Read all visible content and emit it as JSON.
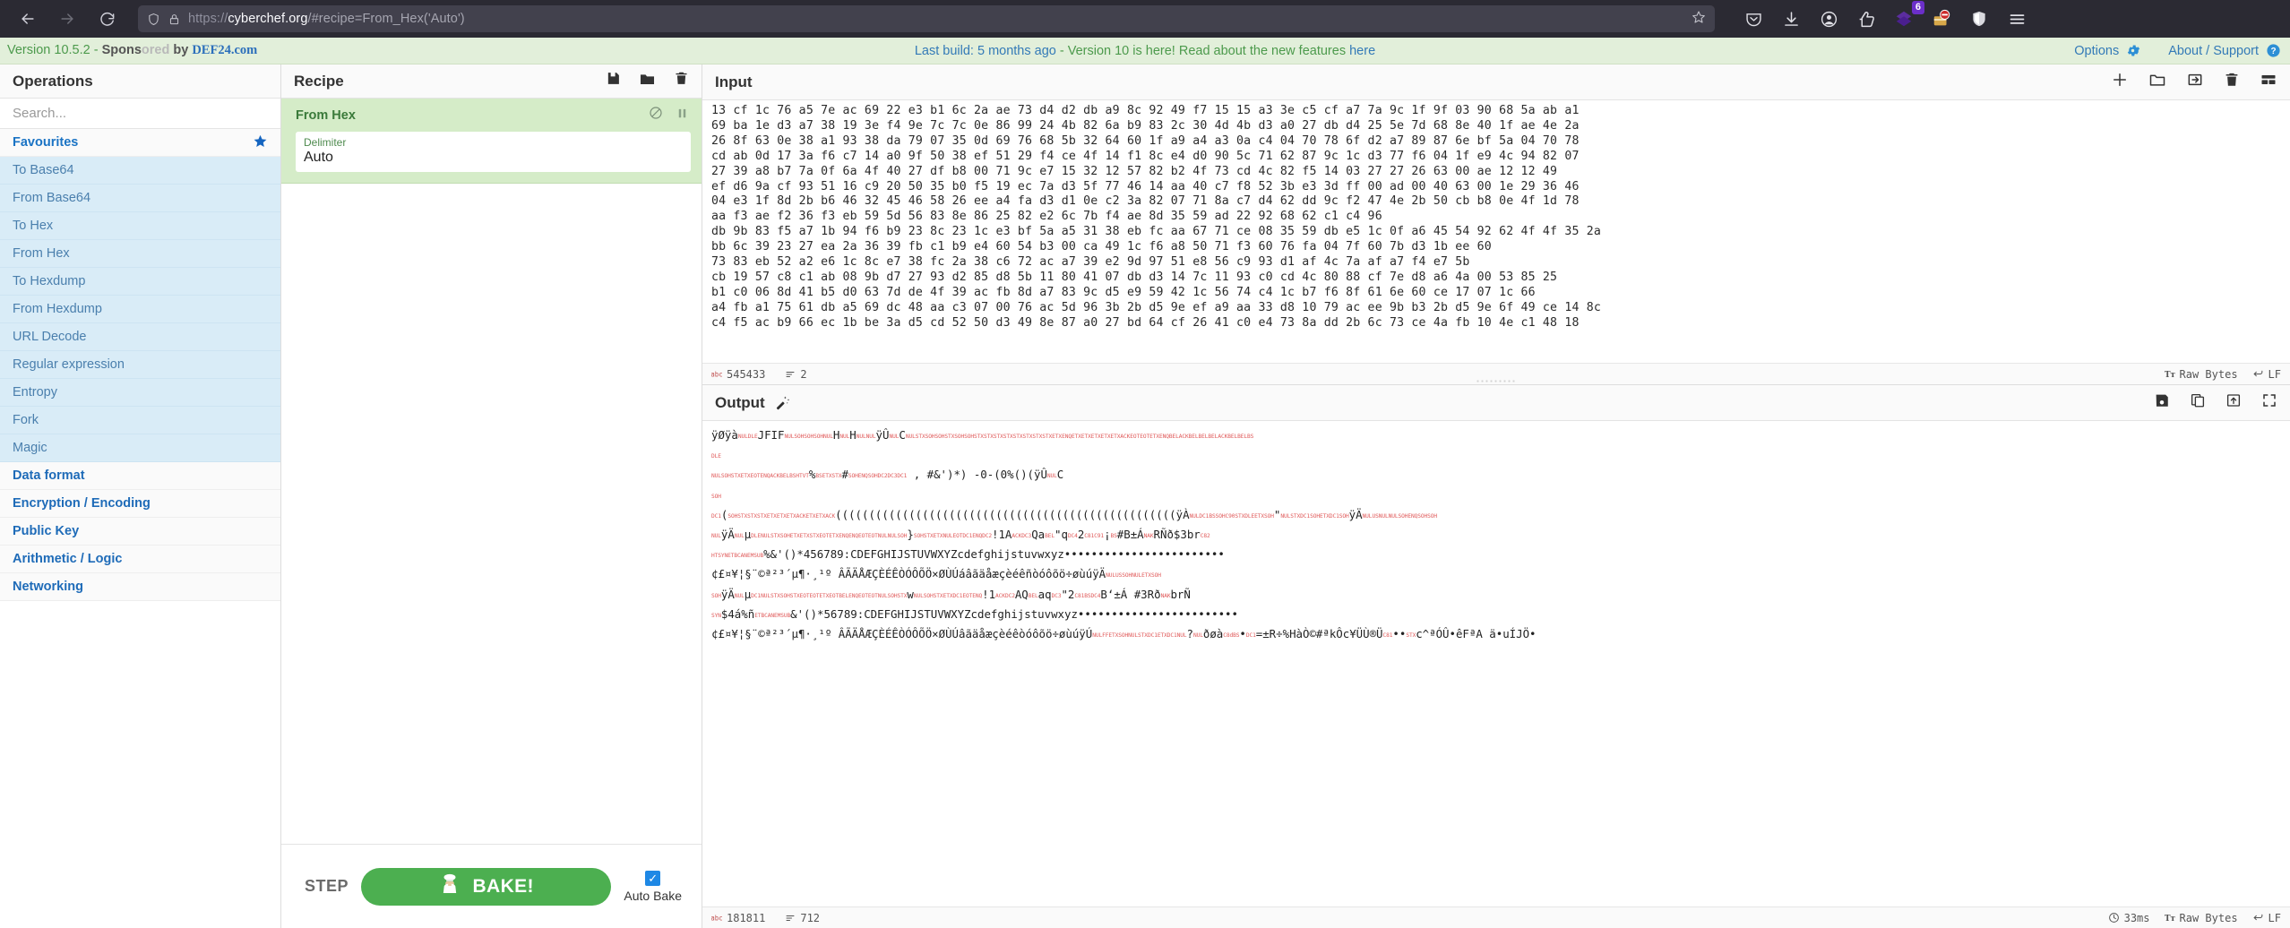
{
  "browser": {
    "back_icon": "back-arrow-icon",
    "forward_icon": "forward-arrow-icon",
    "reload_icon": "reload-icon",
    "url_scheme": "https://",
    "url_host": "cyberchef.org",
    "url_path": "/#recipe=From_Hex('Auto')",
    "url_full": "https://cyberchef.org/#recipe=From_Hex('Auto')",
    "shield_icon": "shield-icon",
    "lock_icon": "lock-icon",
    "bookmark_icon": "star-icon",
    "toolbar_icons": [
      "pocket-icon",
      "downloads-icon",
      "account-icon",
      "sponsorblock-icon",
      "violentmonkey-icon",
      "ublock-origin-icon",
      "bitwarden-icon",
      "hamburger-menu-icon"
    ],
    "violentmonkey_badge": "6"
  },
  "banner": {
    "version_text": "Version 10.5.2",
    "sponsor_dash": " - ",
    "sponsor_prefix": "Spons",
    "sponsor_faded": "ored",
    "sponsor_suffix": " by ",
    "sponsor_link": "DEF24.com",
    "center_build": "Last build: 5 months ago",
    "center_rest": " - Version 10 is here! Read about the new features ",
    "center_link": "here",
    "options_label": "Options",
    "options_icon": "gear-icon",
    "about_label": "About / Support",
    "about_icon": "question-circle-icon",
    "accent_green": "#4c9a4c",
    "accent_blue": "#337ab7",
    "bg": "#e2efda"
  },
  "operations": {
    "title": "Operations",
    "search_placeholder": "Search...",
    "search_value": "",
    "favourites": {
      "label": "Favourites",
      "star_icon": "star-filled-icon",
      "items": [
        "To Base64",
        "From Base64",
        "To Hex",
        "From Hex",
        "To Hexdump",
        "From Hexdump",
        "URL Decode",
        "Regular expression",
        "Entropy",
        "Fork",
        "Magic"
      ]
    },
    "categories": [
      "Data format",
      "Encryption / Encoding",
      "Public Key",
      "Arithmetic / Logic",
      "Networking"
    ]
  },
  "recipe": {
    "title": "Recipe",
    "icons": [
      "save-recipe-icon",
      "load-recipe-icon",
      "clear-recipe-icon"
    ],
    "operations": [
      {
        "name": "From Hex",
        "disable_icon": "disable-icon",
        "breakpoint_icon": "pause-breakpoint-icon",
        "args": [
          {
            "label": "Delimiter",
            "value": "Auto"
          }
        ]
      }
    ],
    "footer": {
      "step_label": "STEP",
      "bake_label": "BAKE!",
      "bake_icon": "chef-icon",
      "bake_color": "#4caf50",
      "autobake_label": "Auto Bake",
      "autobake_checked": true
    }
  },
  "input": {
    "title": "Input",
    "icons": [
      "add-tab-icon",
      "open-folder-icon",
      "open-input-icon",
      "clear-input-icon",
      "tabs-layout-icon"
    ],
    "lines": [
      "13 cf 1c 76 a5 7e ac 69 22 e3 b1 6c 2a ae 73 d4 d2 db a9 8c 92 49 f7 15 15 a3 3e c5 cf a7 7a 9c 1f 9f 03 90 68 5a ab a1",
      "69 ba 1e d3 a7 38 19 3e f4 9e 7c 7c 0e 86 99 24 4b 82 6a b9 83 2c 30 4d 4b d3 a0 27 db d4 25 5e 7d 68 8e 40 1f ae 4e 2a",
      "26 8f 63 0e 38 a1 93 38 da 79 07 35 0d 69 76 68 5b 32 64 60 1f a9 a4 a3 0a c4 04 70 78 6f d2 a7 89 87 6e bf 5a 04 70 78",
      "cd ab 0d 17 3a f6 c7 14 a0 9f 50 38 ef 51 29 f4 ce 4f 14 f1 8c e4 d0 90 5c 71 62 87 9c 1c d3 77 f6 04 1f e9 4c 94 82 07",
      "27 39 a8 b7 7a 0f 6a 4f 40 27 df b8 00 71 9c e7 15 32 12 57 82 b2 4f 73 cd 4c 82 f5 14 03 27 27 26 63 00 ae 12 12 49",
      "ef d6 9a cf 93 51 16 c9 20 50 35 b0 f5 19 ec 7a d3 5f 77 46 14 aa 40 c7 f8 52 3b e3 3d ff 00 ad 00 40 63 00 1e 29 36 46",
      "04 e3 1f 8d 2b b6 46 32 45 46 58 26 ee a4 fa d3 d1 0e c2 3a 82 07 71 8a c7 d4 62 dd 9c f2 47 4e 2b 50 cb b8 0e 4f 1d 78",
      "aa f3 ae f2 36 f3 eb 59 5d 56 83 8e 86 25 82 e2 6c 7b f4 ae 8d 35 59 ad 22 92 68 62 c1 c4 96",
      "db 9b 83 f5 a7 1b 94 f6 b9 23 8c 23 1c e3 bf 5a a5 31 38 eb fc aa 67 71 ce 08 35 59 db e5 1c 0f a6 45 54 92 62 4f 4f 35 2a",
      "bb 6c 39 23 27 ea 2a 36 39 fb c1 b9 e4 60 54 b3 00 ca 49 1c f6 a8 50 71 f3 60 76 fa 04 7f 60 7b d3 1b ee 60",
      "73 83 eb 52 a2 e6 1c 8c e7 38 fc 2a 38 c6 72 ac a7 39 e2 9d 97 51 e8 56 c9 93 d1 af 4c 7a af a7 f4 e7 5b",
      "cb 19 57 c8 c1 ab 08 9b d7 27 93 d2 85 d8 5b 11 80 41 07 db d3 14 7c 11 93 c0 cd 4c 80 88 cf 7e d8 a6 4a 00 53 85 25",
      "b1 c0 06 8d 41 b5 d0 63 7d de 4f 39 ac fb 8d a7 83 9c d5 e9 59 42 1c 56 74 c4 1c b7 f6 8f 61 6e 60 ce 17 07 1c 66",
      "a4 fb a1 75 61 db a5 69 dc 48 aa c3 07 00 76 ac 5d 96 3b 2b d5 9e ef a9 aa 33 d8 10 79 ac ee 9b b3 2b d5 9e 6f 49 ce 14 8c",
      "c4 f5 ac b9 66 ec 1b be 3a d5 cd 52 50 d3 49 8e 87 a0 27 bd 64 cf 26 41 c0 e4 73 8a dd 2b 6c 73 ce 4a fb 10 4e c1 48 18"
    ],
    "status": {
      "length_icon": "character-count-icon",
      "length": "545433",
      "lines_icon": "line-count-icon",
      "lines": "2",
      "encoding_icon": "text-encoding-icon",
      "encoding": "Raw Bytes",
      "eol_icon": "line-ending-icon",
      "eol": "LF"
    }
  },
  "output": {
    "title": "Output",
    "magic_icon": "magic-wand-icon",
    "icons": [
      "save-output-icon",
      "copy-output-icon",
      "replace-input-icon",
      "maximise-output-icon"
    ],
    "lines": [
      "ÿØÿà\u0000\u0010JFIF\u0000\u0001\u0001\u0001\u0000H\u0000H\u0000\u0000ÿÛ\u0000C\u0000\u0002\u0001\u0001\u0002\u0001\u0001\u0002\u0002\u0002\u0002\u0002\u0002\u0002\u0002\u0003\u0005\u0003\u0003\u0003\u0003\u0003\u0006\u0004\u0004\u0003\u0005\u0007\u0006\u0007\u0007\u0007\u0006\u0007\u0007\b",
      "",
      "\u0010",
      "",
      "",
      "\u0000\u0001\u0002\u0003\u0004\u0005\u0006\u0007\b\t\u000b%\b\u0003\u0002#\u0001\u0005\u0001\u0012\u0013\u0011  , #&')*)  -0-(0%()(ÿÛ\u0000C",
      "",
      "\u0001",
      "",
      "",
      "\u0011(\u0001\u0002\u0002\u0002\u0003\u0003\u0003\u0006\u0003\u0003\u0006(((((((((((((((((((((((((((((((((((((((((((((((((((ÿÀ\u0000\u0011\b\u0001\u0002\u0010\u0003\u0001\"\u0000\u0002\u0011\u0001\u0003\u0011\u0001ÿÄ\u0000\u001f\u0000\u0000\u0001\u0005\u0001\u0001",
      "\u0000ÿÄ\u0000µ\u0010\u0000\u0002\u0001\u0003\u0003\u0002\u0004\u0003\u0005\u0005\u0004\u0004\u0000\u0000\u0001}\u0001\u0002\u0003\u0000\u0004\u0011\u0005\u0012!1A\u0006\u0013Qa\u0007\"q\u00142¡\b#B±Á\u0015RÑð$3br",
      "\t\u0016\u0017\u0018\u0019\u001a%&'()*456789:CDEFGHIJSTUVWXYZcdefghijstuvwxyz••••••••••••••••••••••••",
      "¢£¤¥¦§¨©ª²³´µ¶·¸¹º ÂÃÄÅÆÇÈÉÊÒÓÔÕÖ×ØÙÚáâãäåæçèéêñòóôõö÷øùúÿÄ\u0000\u001f\u0001\u0000\u0003\u0001",
      "\u0001ÿÄ\u0000µ\u0011\u0000\u0002\u0001\u0002\u0004\u0004\u0003\u0004\u0007\u0005\u0004\u0004\u0000\u0001\u0002w\u0000\u0001\u0002\u0003\u0011\u0004\u0005!1\u0006\u0012AQ\u0007aq\u0013\"2\b\u0014B‘±Á  #3Rð\u0015brÑ",
      "\u0016$4á%ñ\u0017\u0018\u0019\u001a&'()*56789:CDEFGHIJSTUVWXYZcdefghijstuvwxyz••••••••••••••••••••••••",
      "¢£¤¥¦§¨©ª²³´µ¶·¸¹º ÂÃÄÅÆÇÈÉÊÒÓÔÕÖ×ØÙÚâãäåæçèéêòóôõö÷øùúÿÚ\u0000\f\u0003\u0001\u0000\u0002\u0011\u0003\u0011\u0000?\u0000ðøà\b•\u0011=±R÷%HàÒ©#ªkÔc¥ÜÙ®Ü••\u0002c^ªÓÛ•êFªA ä•uÍJÖ•"
    ],
    "status": {
      "length_icon": "character-count-icon",
      "length": "181811",
      "lines_icon": "line-count-icon",
      "lines": "712",
      "timing_icon": "clock-icon",
      "timing": "33ms",
      "encoding_icon": "text-encoding-icon",
      "encoding": "Raw Bytes",
      "eol_icon": "line-ending-icon",
      "eol": "LF"
    }
  }
}
